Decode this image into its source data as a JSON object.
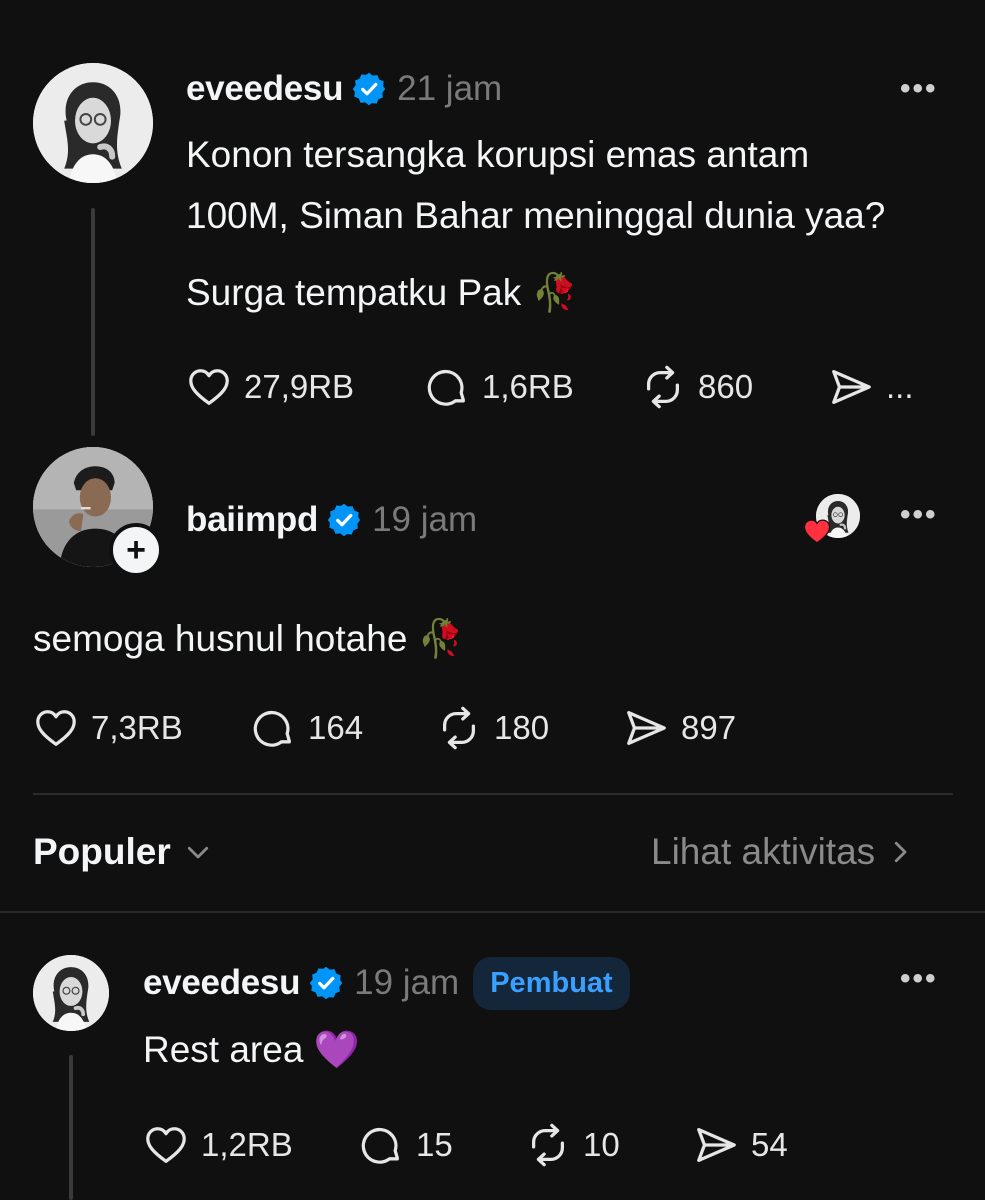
{
  "post": {
    "username": "eveedesu",
    "time": "21 jam",
    "more": "•••",
    "text_line1": "Konon tersangka korupsi emas antam",
    "text_line2": "100M, Siman Bahar meninggal dunia yaa?",
    "text_line3": "Surga tempatku Pak 🥀",
    "likes": "27,9RB",
    "replies": "1,6RB",
    "reposts": "860",
    "shares": "..."
  },
  "reply": {
    "username": "baiimpd",
    "time": "19 jam",
    "more": "•••",
    "text": "semoga husnul hotahe 🥀",
    "likes": "7,3RB",
    "replies": "164",
    "reposts": "180",
    "shares": "897"
  },
  "section": {
    "sort_label": "Populer",
    "activity_link": "Lihat aktivitas"
  },
  "comment": {
    "username": "eveedesu",
    "time": "19 jam",
    "badge": "Pembuat",
    "more": "•••",
    "text": "Rest area 💜",
    "likes": "1,2RB",
    "replies": "15",
    "reposts": "10",
    "shares": "54"
  },
  "icons": {
    "verified": "verified-badge-icon",
    "like": "heart-icon",
    "reply": "comment-icon",
    "repost": "repost-icon",
    "share": "send-icon",
    "liked_by": "heart-red-icon"
  },
  "colors": {
    "background": "#101010",
    "verified_blue": "#0095f6",
    "badge_text": "#3aa0ff",
    "badge_bg": "#13263a",
    "muted": "#7a7a7a",
    "heart_red": "#ff3040"
  }
}
